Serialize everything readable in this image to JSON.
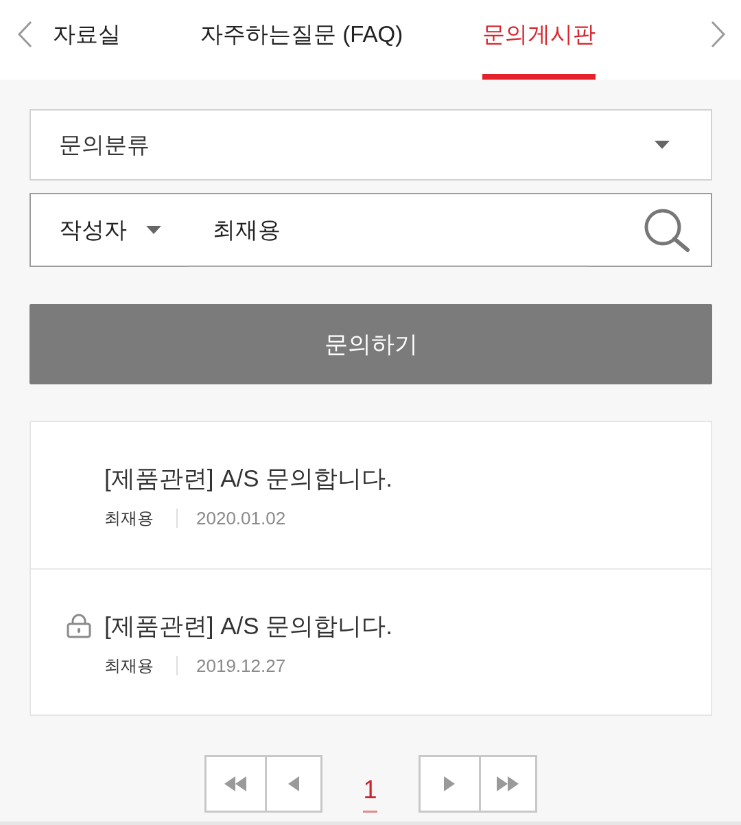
{
  "tabs": [
    {
      "label": "자료실",
      "selected": false
    },
    {
      "label": "자주하는질문 (FAQ)",
      "selected": false
    },
    {
      "label": "문의게시판",
      "selected": true
    }
  ],
  "filters": {
    "category_select": {
      "label": "문의분류"
    },
    "search": {
      "type_select": "작성자",
      "value": "최재용"
    }
  },
  "ask_button": {
    "label": "문의하기"
  },
  "posts": [
    {
      "title": "[제품관련] A/S 문의합니다.",
      "author": "최재용",
      "date": "2020.01.02",
      "locked": false
    },
    {
      "title": "[제품관련] A/S 문의합니다.",
      "author": "최재용",
      "date": "2019.12.27",
      "locked": true
    }
  ],
  "pagination": {
    "pages": [
      {
        "label": "1",
        "selected": true
      }
    ]
  }
}
